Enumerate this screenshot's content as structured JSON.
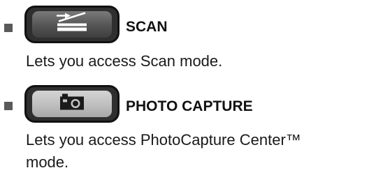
{
  "items": [
    {
      "icon": "scan-icon",
      "label": "SCAN",
      "description": "Lets you access Scan mode."
    },
    {
      "icon": "camera-icon",
      "label": "PHOTO CAPTURE",
      "description_line1": "Lets you access PhotoCapture Center™",
      "description_line2": "mode."
    }
  ]
}
